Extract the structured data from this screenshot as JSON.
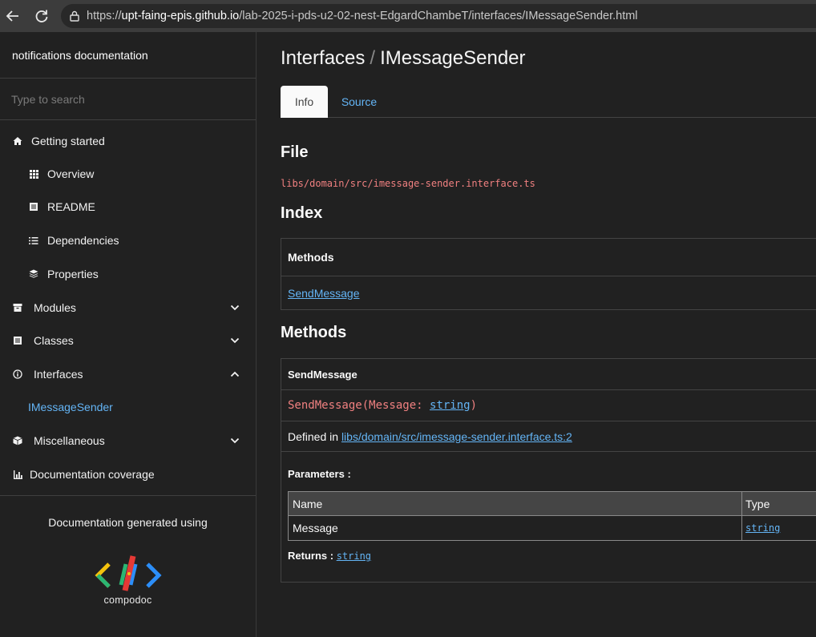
{
  "browser": {
    "url_prefix": "https://",
    "url_host": "upt-faing-epis.github.io",
    "url_path": "/lab-2025-i-pds-u2-02-nest-EdgardChambeT/interfaces/IMessageSender.html"
  },
  "sidebar": {
    "title": "notifications documentation",
    "search_placeholder": "Type to search",
    "items": [
      {
        "label": "Getting started",
        "icon": "home-icon"
      },
      {
        "label": "Overview",
        "icon": "grid-icon"
      },
      {
        "label": "README",
        "icon": "book-icon"
      },
      {
        "label": "Dependencies",
        "icon": "list-icon"
      },
      {
        "label": "Properties",
        "icon": "layers-icon"
      },
      {
        "label": "Modules",
        "icon": "archive-icon"
      },
      {
        "label": "Classes",
        "icon": "file-icon"
      },
      {
        "label": "Interfaces",
        "icon": "info-icon"
      },
      {
        "label": "IMessageSender",
        "icon": ""
      },
      {
        "label": "Miscellaneous",
        "icon": "cube-icon"
      },
      {
        "label": "Documentation coverage",
        "icon": "bar-chart-icon"
      }
    ],
    "footer_text": "Documentation generated using",
    "logo_text": "compodoc"
  },
  "main": {
    "breadcrumb_parent": "Interfaces",
    "breadcrumb_sep": "/",
    "breadcrumb_current": "IMessageSender",
    "tabs": [
      {
        "label": "Info"
      },
      {
        "label": "Source"
      }
    ],
    "file_heading": "File",
    "file_path": "libs/domain/src/imessage-sender.interface.ts",
    "index_heading": "Index",
    "index_methods_header": "Methods",
    "index_method_link": "SendMessage",
    "methods_heading": "Methods",
    "method": {
      "name": "SendMessage",
      "signature_prefix": "SendMessage(Message: ",
      "signature_type": "string",
      "signature_suffix": ")",
      "defined_in_label": "Defined in",
      "defined_in_link": "libs/domain/src/imessage-sender.interface.ts:2",
      "parameters_label": "Parameters :",
      "param_headers": [
        "Name",
        "Type"
      ],
      "params": [
        {
          "name": "Message",
          "type": "string"
        }
      ],
      "returns_label": "Returns :",
      "returns_type": "string"
    }
  },
  "colors": {
    "link": "#64b5f6",
    "code": "#f08080",
    "background": "#212121"
  }
}
